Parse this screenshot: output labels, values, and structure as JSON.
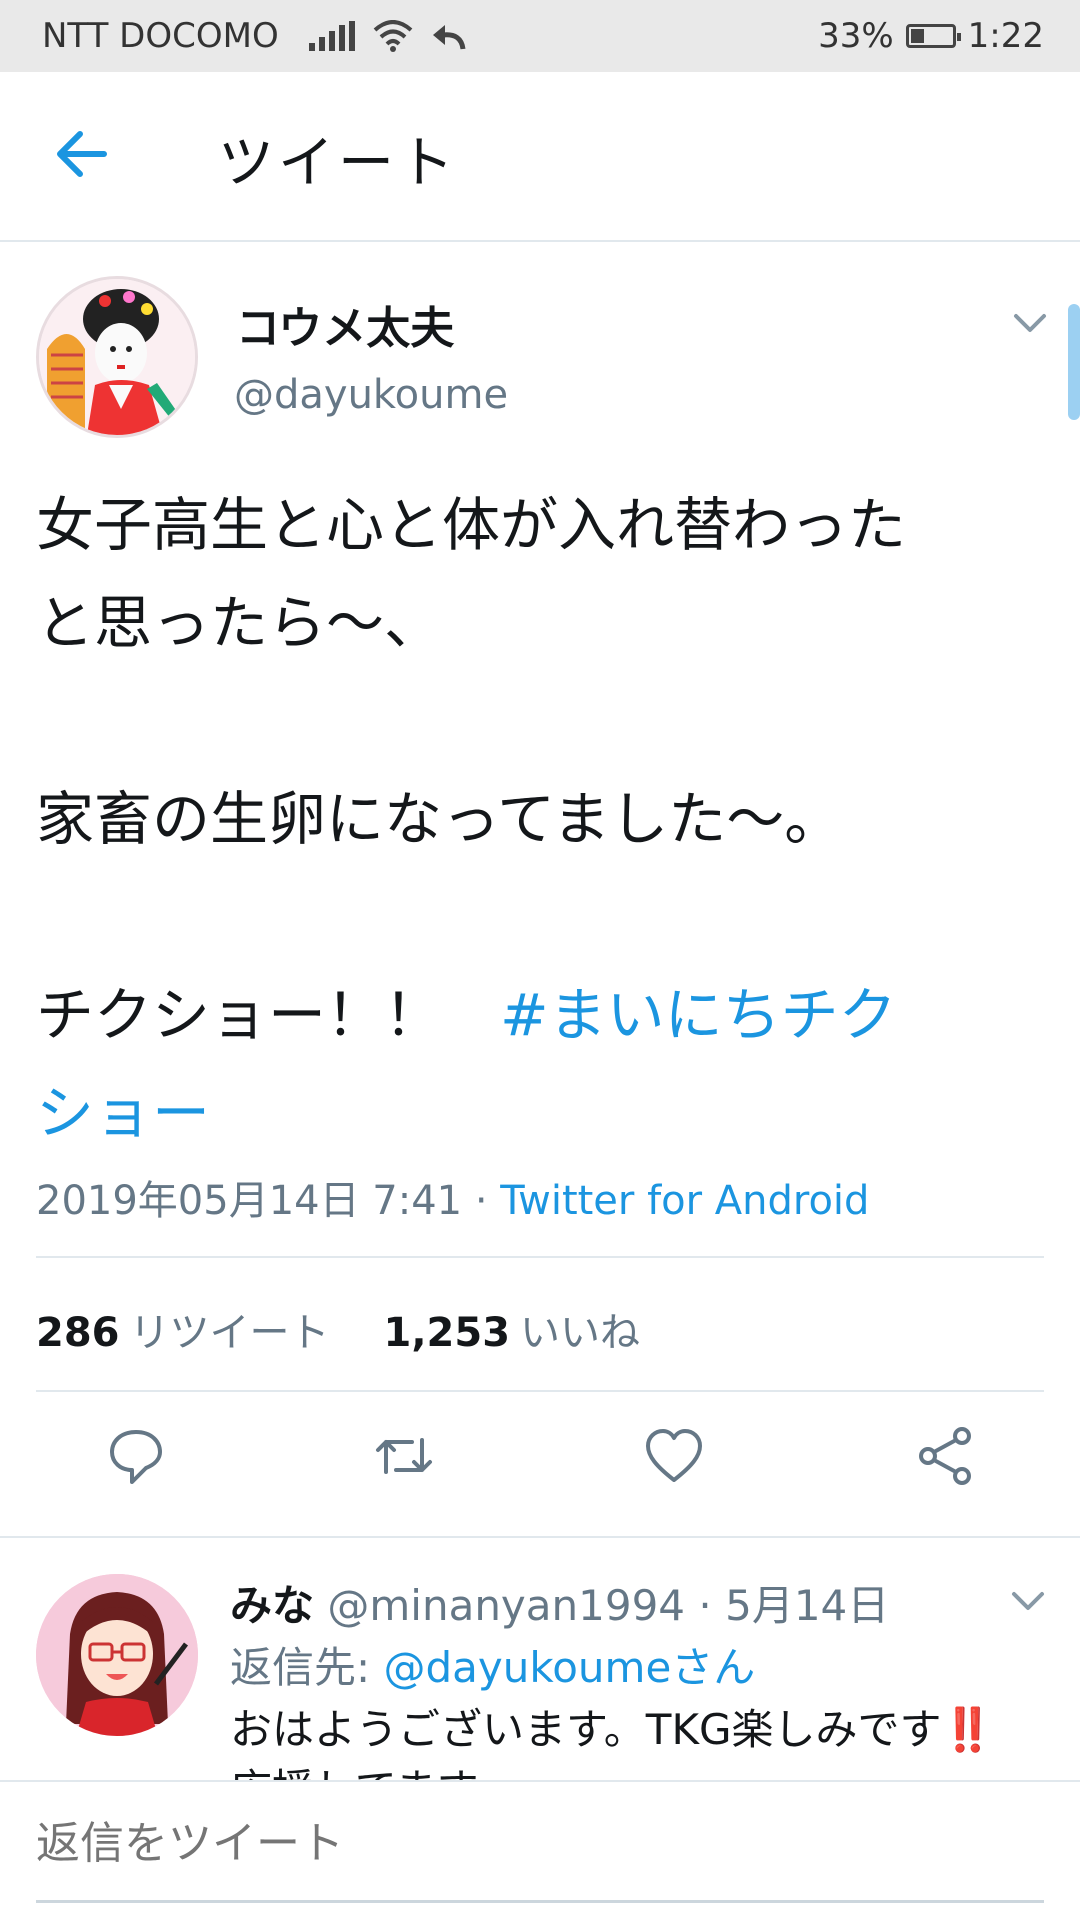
{
  "status_bar": {
    "carrier": "NTT DOCOMO",
    "battery_percent": "33%",
    "battery_level": 0.33,
    "time": "1:22",
    "icons": [
      "signal-icon",
      "wifi-icon",
      "share-arrow-icon",
      "battery-icon"
    ]
  },
  "header": {
    "title": "ツイート",
    "back_icon": "back-arrow-icon"
  },
  "tweet": {
    "display_name": "コウメ太夫",
    "handle": "@dayukoume",
    "lines": [
      "女子高生と心と体が入れ替わった",
      "と思ったら〜、",
      "家畜の生卵になってました〜。",
      "チクショー！！　"
    ],
    "hashtag": "#まいにちチクショー",
    "hashtag_part1": "#まいにちチク",
    "hashtag_part2": "ショー",
    "timestamp": "2019年05月14日 7:41",
    "separator": " · ",
    "via": "Twitter for Android",
    "retweet_count": "286",
    "retweet_label": "リツイート",
    "like_count": "1,253",
    "like_label": "いいね"
  },
  "actions": [
    {
      "name": "reply-icon"
    },
    {
      "name": "retweet-icon"
    },
    {
      "name": "like-icon"
    },
    {
      "name": "share-icon"
    }
  ],
  "reply": {
    "name": "みな",
    "handle": "@minanyan1994",
    "separator": " · ",
    "date": "5月14日",
    "reply_to_label": "返信先: ",
    "reply_to_link": "@dayukoumeさん",
    "text": "おはようございます。TKG楽しみです",
    "text_emoji": "‼️",
    "text_line2": "応援してます"
  },
  "compose": {
    "placeholder": "返信をツイート"
  },
  "colors": {
    "accent": "#1b95e0",
    "text": "#14171a",
    "secondary": "#657786",
    "divider": "#e1e8ed",
    "status_bar_bg": "#e9e9e9"
  }
}
